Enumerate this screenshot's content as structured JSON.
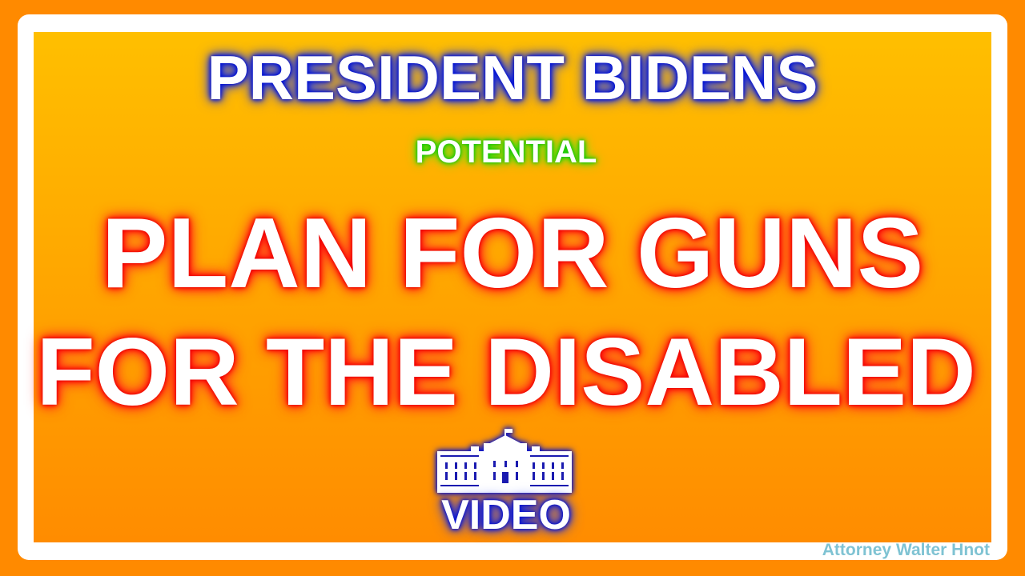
{
  "headline": {
    "line1": "PRESIDENT BIDENS",
    "line2": "POTENTIAL",
    "line3": "PLAN FOR GUNS",
    "line4": "FOR THE DISABLED"
  },
  "badge": {
    "icon": "white-house-icon",
    "label": "VIDEO"
  },
  "credit": "Attorney Walter Hnot",
  "colors": {
    "background": "#ff8a00",
    "frame": "#ffffff",
    "glow_blue": "#0010d0",
    "glow_green": "#00c000",
    "glow_red": "#ff0000",
    "credit": "#7fc3d3"
  }
}
